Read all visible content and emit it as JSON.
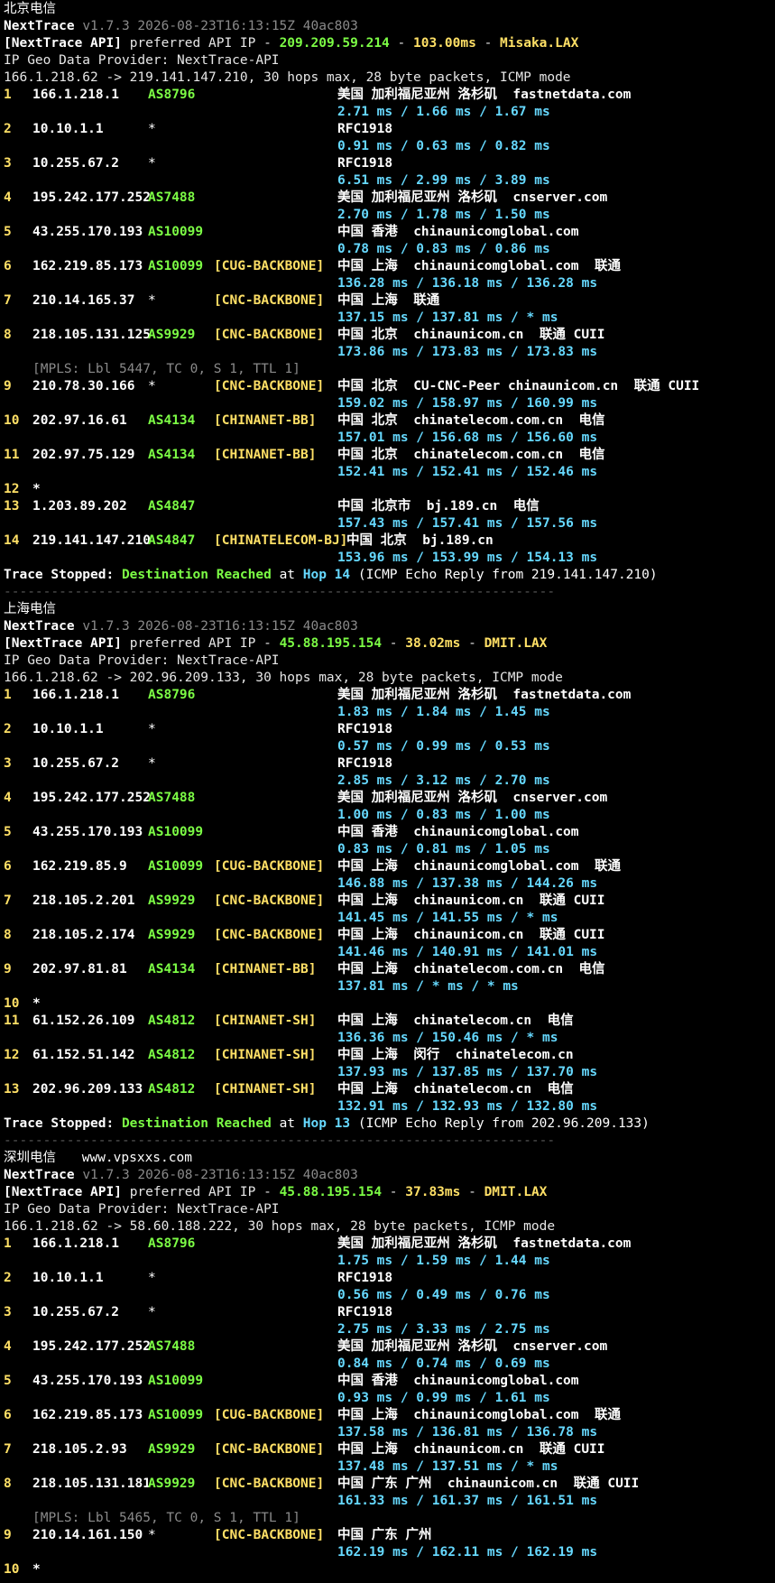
{
  "sections": [
    {
      "title": "北京电信",
      "title_extra": "",
      "version_app": "NextTrace",
      "version_info": "v1.7.3 2026-08-23T16:13:15Z 40ac803",
      "api_tag": "[NextTrace API]",
      "api_text": "preferred API IP -",
      "api_ip": "209.209.59.214",
      "api_dash": "-",
      "api_ms": "103.00ms",
      "api_dash2": "-",
      "api_node": "Misaka.LAX",
      "geo_provider": "IP Geo Data Provider: NextTrace-API",
      "trace_header": "166.1.218.62 -> 219.141.147.210, 30 hops max, 28 byte packets, ICMP mode",
      "hops": [
        {
          "n": "1",
          "ip": "166.1.218.1",
          "as": "AS8796",
          "tag": "",
          "geo": "美国 加利福尼亚州 洛杉矶",
          "host": "fastnetdata.com",
          "extra": "",
          "rtt": "2.71 ms / 1.66 ms / 1.67 ms"
        },
        {
          "n": "2",
          "ip": "10.10.1.1",
          "as": "*",
          "tag": "",
          "geo": "RFC1918",
          "host": "",
          "extra": "",
          "rtt": "0.91 ms / 0.63 ms / 0.82 ms"
        },
        {
          "n": "3",
          "ip": "10.255.67.2",
          "as": "*",
          "tag": "",
          "geo": "RFC1918",
          "host": "",
          "extra": "",
          "rtt": "6.51 ms / 2.99 ms / 3.89 ms"
        },
        {
          "n": "4",
          "ip": "195.242.177.252",
          "as": "AS7488",
          "tag": "",
          "geo": "美国 加利福尼亚州 洛杉矶",
          "host": "cnserver.com",
          "extra": "",
          "rtt": "2.70 ms / 1.78 ms / 1.50 ms"
        },
        {
          "n": "5",
          "ip": "43.255.170.193",
          "as": "AS10099",
          "tag": "",
          "geo": "中国 香港",
          "host": "chinaunicomglobal.com",
          "extra": "",
          "rtt": "0.78 ms / 0.83 ms / 0.86 ms"
        },
        {
          "n": "6",
          "ip": "162.219.85.173",
          "as": "AS10099",
          "tag": "[CUG-BACKBONE]",
          "geo": "中国 上海",
          "host": "chinaunicomglobal.com",
          "extra": "联通",
          "rtt": "136.28 ms / 136.18 ms / 136.28 ms"
        },
        {
          "n": "7",
          "ip": "210.14.165.37",
          "as": "*",
          "tag": "[CNC-BACKBONE]",
          "geo": "中国 上海",
          "host": "联通",
          "extra": "",
          "rtt": "137.15 ms / 137.81 ms / * ms"
        },
        {
          "n": "8",
          "ip": "218.105.131.125",
          "as": "AS9929",
          "tag": "[CNC-BACKBONE]",
          "geo": "中国 北京",
          "host": "chinaunicom.cn",
          "extra": "联通 CUII",
          "rtt": "173.86 ms / 173.83 ms / 173.83 ms",
          "mpls": "[MPLS: Lbl 5447, TC 0, S 1, TTL 1]"
        },
        {
          "n": "9",
          "ip": "210.78.30.166",
          "as": "*",
          "tag": "[CNC-BACKBONE]",
          "geo": "中国 北京",
          "host": "CU-CNC-Peer chinaunicom.cn",
          "extra": "联通 CUII",
          "rtt": "159.02 ms / 158.97 ms / 160.99 ms"
        },
        {
          "n": "10",
          "ip": "202.97.16.61",
          "as": "AS4134",
          "tag": "[CHINANET-BB]",
          "geo": "中国 北京",
          "host": "chinatelecom.com.cn",
          "extra": "电信",
          "rtt": "157.01 ms / 156.68 ms / 156.60 ms"
        },
        {
          "n": "11",
          "ip": "202.97.75.129",
          "as": "AS4134",
          "tag": "[CHINANET-BB]",
          "geo": "中国 北京",
          "host": "chinatelecom.com.cn",
          "extra": "电信",
          "rtt": "152.41 ms / 152.41 ms / 152.46 ms"
        },
        {
          "n": "12",
          "star": "*"
        },
        {
          "n": "13",
          "ip": "1.203.89.202",
          "as": "AS4847",
          "tag": "",
          "geo": "中国 北京市",
          "host": "bj.189.cn",
          "extra": "电信",
          "rtt": "157.43 ms / 157.41 ms / 157.56 ms"
        },
        {
          "n": "14",
          "ip": "219.141.147.210",
          "as": "AS4847",
          "tag": "[CHINATELECOM-BJ]",
          "geo": "中国 北京",
          "host": "bj.189.cn",
          "extra": "",
          "rtt": "153.96 ms / 153.99 ms / 154.13 ms",
          "wide": true
        }
      ],
      "stop": {
        "label": "Trace Stopped:",
        "reached": "Destination Reached",
        "at": "at",
        "hop": "Hop 14",
        "rest": "(ICMP Echo Reply from 219.141.147.210)"
      }
    },
    {
      "title": "上海电信",
      "title_extra": "",
      "version_app": "NextTrace",
      "version_info": "v1.7.3 2026-08-23T16:13:15Z 40ac803",
      "api_tag": "[NextTrace API]",
      "api_text": "preferred API IP -",
      "api_ip": "45.88.195.154",
      "api_dash": "-",
      "api_ms": "38.02ms",
      "api_dash2": "-",
      "api_node": "DMIT.LAX",
      "geo_provider": "IP Geo Data Provider: NextTrace-API",
      "trace_header": "166.1.218.62 -> 202.96.209.133, 30 hops max, 28 byte packets, ICMP mode",
      "hops": [
        {
          "n": "1",
          "ip": "166.1.218.1",
          "as": "AS8796",
          "tag": "",
          "geo": "美国 加利福尼亚州 洛杉矶",
          "host": "fastnetdata.com",
          "extra": "",
          "rtt": "1.83 ms / 1.84 ms / 1.45 ms"
        },
        {
          "n": "2",
          "ip": "10.10.1.1",
          "as": "*",
          "tag": "",
          "geo": "RFC1918",
          "host": "",
          "extra": "",
          "rtt": "0.57 ms / 0.99 ms / 0.53 ms"
        },
        {
          "n": "3",
          "ip": "10.255.67.2",
          "as": "*",
          "tag": "",
          "geo": "RFC1918",
          "host": "",
          "extra": "",
          "rtt": "2.85 ms / 3.12 ms / 2.70 ms"
        },
        {
          "n": "4",
          "ip": "195.242.177.252",
          "as": "AS7488",
          "tag": "",
          "geo": "美国 加利福尼亚州 洛杉矶",
          "host": "cnserver.com",
          "extra": "",
          "rtt": "1.00 ms / 0.83 ms / 1.00 ms"
        },
        {
          "n": "5",
          "ip": "43.255.170.193",
          "as": "AS10099",
          "tag": "",
          "geo": "中国 香港",
          "host": "chinaunicomglobal.com",
          "extra": "",
          "rtt": "0.83 ms / 0.81 ms / 1.05 ms"
        },
        {
          "n": "6",
          "ip": "162.219.85.9",
          "as": "AS10099",
          "tag": "[CUG-BACKBONE]",
          "geo": "中国 上海",
          "host": "chinaunicomglobal.com",
          "extra": "联通",
          "rtt": "146.88 ms / 137.38 ms / 144.26 ms"
        },
        {
          "n": "7",
          "ip": "218.105.2.201",
          "as": "AS9929",
          "tag": "[CNC-BACKBONE]",
          "geo": "中国 上海",
          "host": "chinaunicom.cn",
          "extra": "联通 CUII",
          "rtt": "141.45 ms / 141.55 ms / * ms"
        },
        {
          "n": "8",
          "ip": "218.105.2.174",
          "as": "AS9929",
          "tag": "[CNC-BACKBONE]",
          "geo": "中国 上海",
          "host": "chinaunicom.cn",
          "extra": "联通 CUII",
          "rtt": "141.46 ms / 140.91 ms / 141.01 ms"
        },
        {
          "n": "9",
          "ip": "202.97.81.81",
          "as": "AS4134",
          "tag": "[CHINANET-BB]",
          "geo": "中国 上海",
          "host": "chinatelecom.com.cn",
          "extra": "电信",
          "rtt": "137.81 ms / * ms / * ms"
        },
        {
          "n": "10",
          "star": "*"
        },
        {
          "n": "11",
          "ip": "61.152.26.109",
          "as": "AS4812",
          "tag": "[CHINANET-SH]",
          "geo": "中国 上海",
          "host": "chinatelecom.cn",
          "extra": "电信",
          "rtt": "136.36 ms / 150.46 ms / * ms"
        },
        {
          "n": "12",
          "ip": "61.152.51.142",
          "as": "AS4812",
          "tag": "[CHINANET-SH]",
          "geo": "中国 上海  闵行",
          "host": "chinatelecom.cn",
          "extra": "",
          "rtt": "137.93 ms / 137.85 ms / 137.70 ms"
        },
        {
          "n": "13",
          "ip": "202.96.209.133",
          "as": "AS4812",
          "tag": "[CHINANET-SH]",
          "geo": "中国 上海",
          "host": "chinatelecom.cn",
          "extra": "电信",
          "rtt": "132.91 ms / 132.93 ms / 132.80 ms"
        }
      ],
      "stop": {
        "label": "Trace Stopped:",
        "reached": "Destination Reached",
        "at": "at",
        "hop": "Hop 13",
        "rest": "(ICMP Echo Reply from 202.96.209.133)"
      }
    },
    {
      "title": "深圳电信",
      "title_extra": "www.vpsxxs.com",
      "version_app": "NextTrace",
      "version_info": "v1.7.3 2026-08-23T16:13:15Z 40ac803",
      "api_tag": "[NextTrace API]",
      "api_text": "preferred API IP -",
      "api_ip": "45.88.195.154",
      "api_dash": "-",
      "api_ms": "37.83ms",
      "api_dash2": "-",
      "api_node": "DMIT.LAX",
      "geo_provider": "IP Geo Data Provider: NextTrace-API",
      "trace_header": "166.1.218.62 -> 58.60.188.222, 30 hops max, 28 byte packets, ICMP mode",
      "hops": [
        {
          "n": "1",
          "ip": "166.1.218.1",
          "as": "AS8796",
          "tag": "",
          "geo": "美国 加利福尼亚州 洛杉矶",
          "host": "fastnetdata.com",
          "extra": "",
          "rtt": "1.75 ms / 1.59 ms / 1.44 ms"
        },
        {
          "n": "2",
          "ip": "10.10.1.1",
          "as": "*",
          "tag": "",
          "geo": "RFC1918",
          "host": "",
          "extra": "",
          "rtt": "0.56 ms / 0.49 ms / 0.76 ms"
        },
        {
          "n": "3",
          "ip": "10.255.67.2",
          "as": "*",
          "tag": "",
          "geo": "RFC1918",
          "host": "",
          "extra": "",
          "rtt": "2.75 ms / 3.33 ms / 2.75 ms"
        },
        {
          "n": "4",
          "ip": "195.242.177.252",
          "as": "AS7488",
          "tag": "",
          "geo": "美国 加利福尼亚州 洛杉矶",
          "host": "cnserver.com",
          "extra": "",
          "rtt": "0.84 ms / 0.74 ms / 0.69 ms"
        },
        {
          "n": "5",
          "ip": "43.255.170.193",
          "as": "AS10099",
          "tag": "",
          "geo": "中国 香港",
          "host": "chinaunicomglobal.com",
          "extra": "",
          "rtt": "0.93 ms / 0.99 ms / 1.61 ms"
        },
        {
          "n": "6",
          "ip": "162.219.85.173",
          "as": "AS10099",
          "tag": "[CUG-BACKBONE]",
          "geo": "中国 上海",
          "host": "chinaunicomglobal.com",
          "extra": "联通",
          "rtt": "137.58 ms / 136.81 ms / 136.78 ms"
        },
        {
          "n": "7",
          "ip": "218.105.2.93",
          "as": "AS9929",
          "tag": "[CNC-BACKBONE]",
          "geo": "中国 上海",
          "host": "chinaunicom.cn",
          "extra": "联通 CUII",
          "rtt": "137.48 ms / 137.51 ms / * ms"
        },
        {
          "n": "8",
          "ip": "218.105.131.181",
          "as": "AS9929",
          "tag": "[CNC-BACKBONE]",
          "geo": "中国 广东 广州",
          "host": "chinaunicom.cn",
          "extra": "联通 CUII",
          "rtt": "161.33 ms / 161.37 ms / 161.51 ms",
          "mpls": "[MPLS: Lbl 5465, TC 0, S 1, TTL 1]"
        },
        {
          "n": "9",
          "ip": "210.14.161.150",
          "as": "*",
          "tag": "[CNC-BACKBONE]",
          "geo": "中国 广东 广州",
          "host": "",
          "extra": "",
          "rtt": "162.19 ms / 162.11 ms / 162.19 ms"
        },
        {
          "n": "10",
          "star": "*"
        }
      ]
    }
  ],
  "separator": "----------------------------------------------------------------------",
  "colors": {
    "background": "#000000",
    "text": "#e6e6e6",
    "as_number": "#7CFC45",
    "backbone_tag": "#ffe066",
    "rtt": "#66d9ff",
    "dim": "#8a8a8a"
  }
}
